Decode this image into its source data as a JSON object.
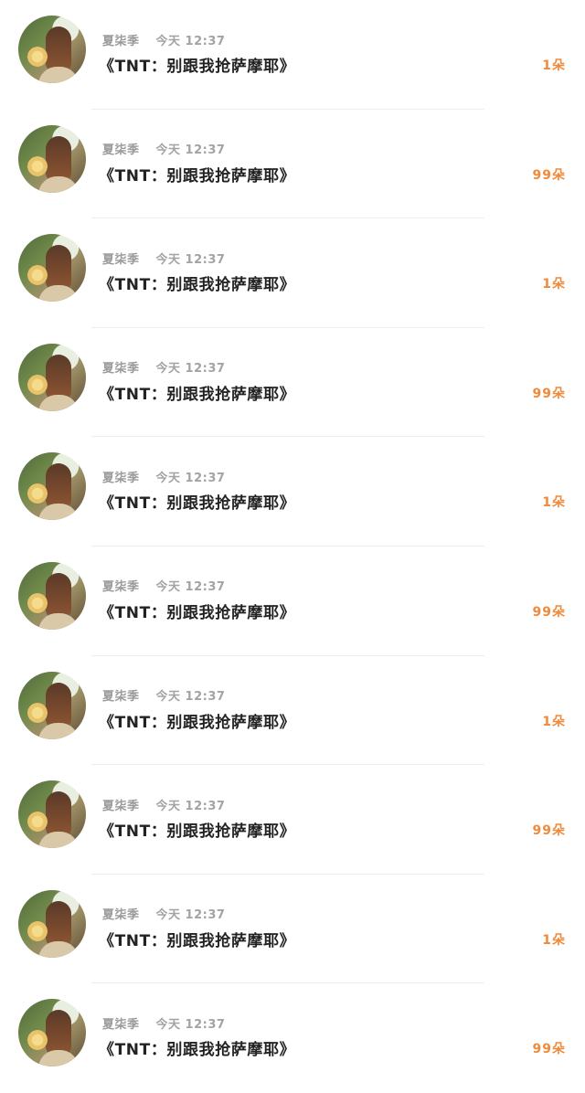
{
  "items": [
    {
      "author": "夏柒季",
      "time": "今天 12:37",
      "title": "《TNT：别跟我抢萨摩耶》",
      "count": "1朵"
    },
    {
      "author": "夏柒季",
      "time": "今天 12:37",
      "title": "《TNT：别跟我抢萨摩耶》",
      "count": "99朵"
    },
    {
      "author": "夏柒季",
      "time": "今天 12:37",
      "title": "《TNT：别跟我抢萨摩耶》",
      "count": "1朵"
    },
    {
      "author": "夏柒季",
      "time": "今天 12:37",
      "title": "《TNT：别跟我抢萨摩耶》",
      "count": "99朵"
    },
    {
      "author": "夏柒季",
      "time": "今天 12:37",
      "title": "《TNT：别跟我抢萨摩耶》",
      "count": "1朵"
    },
    {
      "author": "夏柒季",
      "time": "今天 12:37",
      "title": "《TNT：别跟我抢萨摩耶》",
      "count": "99朵"
    },
    {
      "author": "夏柒季",
      "time": "今天 12:37",
      "title": "《TNT：别跟我抢萨摩耶》",
      "count": "1朵"
    },
    {
      "author": "夏柒季",
      "time": "今天 12:37",
      "title": "《TNT：别跟我抢萨摩耶》",
      "count": "99朵"
    },
    {
      "author": "夏柒季",
      "time": "今天 12:37",
      "title": "《TNT：别跟我抢萨摩耶》",
      "count": "1朵"
    },
    {
      "author": "夏柒季",
      "time": "今天 12:37",
      "title": "《TNT：别跟我抢萨摩耶》",
      "count": "99朵"
    }
  ],
  "colors": {
    "count_accent": "#f08a3a",
    "title_text": "#222222",
    "meta_text": "#9a9a9a"
  }
}
